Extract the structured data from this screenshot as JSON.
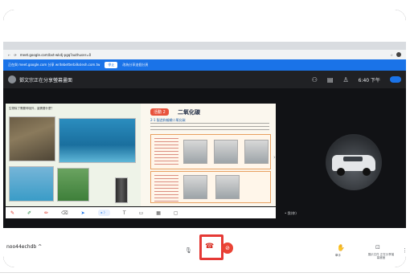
{
  "browser": {
    "url": "meet.google.com/bxt-wkdj-pgq?authuser=0",
    "banner_text": "正在與 meet.google.com 分享 writebetterbilkslesh.com.tw",
    "banner_button": "停止",
    "banner_link": "改為分享這個分頁"
  },
  "meet": {
    "title": "鄧文宗正在分享螢幕畫面",
    "clock": "6:40 下午",
    "meeting_code": "noo44echdb",
    "you_label": "• 我(你)",
    "raise_hand_label": "舉手",
    "present_label": "展示文件 正在分享螢幕畫面"
  },
  "slide": {
    "activity_badge": "活動 2",
    "activity_title": "二氧化碳",
    "subheading": "2-1 製造和檢驗二氧化碳",
    "caption": "生物除了需要呼吸外，還需要什麼？"
  },
  "icons": {
    "back": "back-arrow-icon",
    "reload": "reload-icon",
    "chevron": "chevron-up-icon",
    "mic": "microphone-icon",
    "hangup": "phone-hangup-icon",
    "camera_off": "camera-off-icon",
    "hand": "raise-hand-icon",
    "present": "present-icon",
    "more": "more-vertical-icon"
  },
  "colors": {
    "hangup_highlight": "#e53935",
    "banner": "#1a73e8",
    "activity_badge": "#e8523c"
  }
}
